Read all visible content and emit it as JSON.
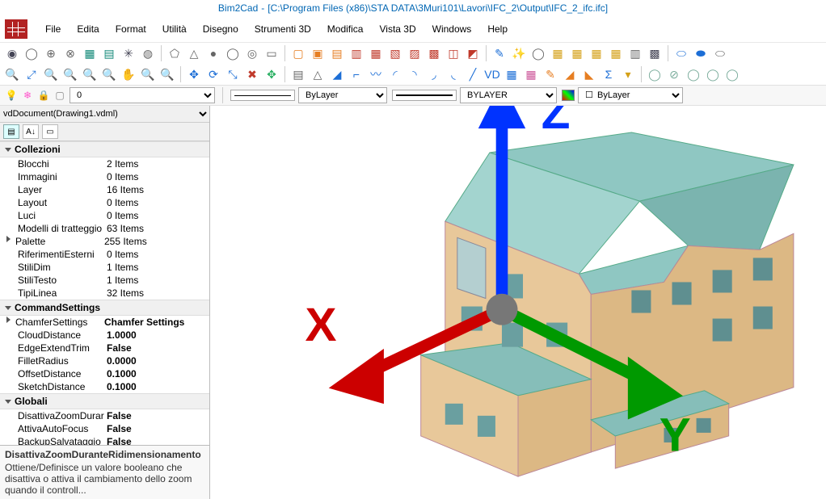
{
  "title_app": "Bim2Cad",
  "title_path": "[C:\\Program Files (x86)\\STA DATA\\3Muri101\\Lavori\\IFC_2\\Output\\IFC_2_ifc.ifc]",
  "menu": [
    "File",
    "Edita",
    "Format",
    "Utilità",
    "Disegno",
    "Strumenti 3D",
    "Modifica",
    "Vista 3D",
    "Windows",
    "Help"
  ],
  "propbar": {
    "layer_value": "0",
    "linetype_label": "ByLayer",
    "lineweight_label": "BYLAYER",
    "color_label": "ByLayer"
  },
  "doc_select": "vdDocument(Drawing1.vdml)",
  "sections": [
    {
      "name": "Collezioni",
      "rows": [
        {
          "k": "Blocchi",
          "v": "2 Items"
        },
        {
          "k": "Immagini",
          "v": "0 Items"
        },
        {
          "k": "Layer",
          "v": "16 Items"
        },
        {
          "k": "Layout",
          "v": "0 Items"
        },
        {
          "k": "Luci",
          "v": "0 Items"
        },
        {
          "k": "Modelli di tratteggio",
          "v": "63 Items"
        },
        {
          "k": "Palette",
          "v": "255 Items",
          "tri": true
        },
        {
          "k": "RiferimentiEsterni",
          "v": "0 Items"
        },
        {
          "k": "StiliDim",
          "v": "1 Items"
        },
        {
          "k": "StiliTesto",
          "v": "1 Items"
        },
        {
          "k": "TipiLinea",
          "v": "32 Items"
        }
      ]
    },
    {
      "name": "CommandSettings",
      "rows": [
        {
          "k": "ChamferSettings",
          "v": "Chamfer Settings",
          "bold": true,
          "tri": true
        },
        {
          "k": "CloudDistance",
          "v": "1.0000",
          "bold": true
        },
        {
          "k": "EdgeExtendTrim",
          "v": "False",
          "bold": true
        },
        {
          "k": "FilletRadius",
          "v": "0.0000",
          "bold": true
        },
        {
          "k": "OffsetDistance",
          "v": "0.1000",
          "bold": true
        },
        {
          "k": "SketchDistance",
          "v": "0.1000",
          "bold": true
        }
      ]
    },
    {
      "name": "Globali",
      "rows": [
        {
          "k": "DisattivaZoomDurar",
          "v": "False",
          "bold": true
        },
        {
          "k": "AttivaAutoFocus",
          "v": "False",
          "bold": true
        },
        {
          "k": "BackupSalvataggio",
          "v": "False",
          "bold": true
        }
      ]
    }
  ],
  "desc": {
    "title": "DisattivaZoomDuranteRidimensionamento",
    "body": "Ottiene/Definisce un valore booleano che disattiva o attiva il cambiamento dello zoom quando il controll..."
  },
  "axis": {
    "x": "X",
    "y": "Y",
    "z": "Z"
  }
}
